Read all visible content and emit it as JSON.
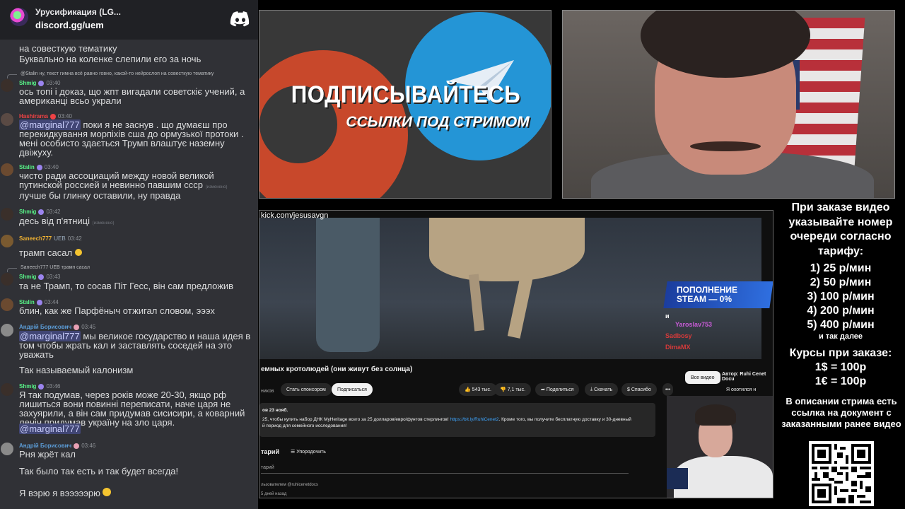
{
  "discord": {
    "server_name": "Урусификация (LG...",
    "invite": "discord.gg/uem"
  },
  "chat": {
    "top_lines": [
      "на совесткую тематику",
      "Буквально на коленке слепили его за ночь"
    ],
    "messages": [
      {
        "reply": "@Stalin ну, текст гимна всё равно говно, какой-то нейрослоп на совесткую тематику",
        "user": "Shmig",
        "color": "#57f287",
        "time": "03:40",
        "text": "ось топі і доказ, що жпт вигадали советскіє учений, а американці всьо украли"
      },
      {
        "user": "Hashirama",
        "color": "#ed4245",
        "time": "03:40",
        "mention": "@marginal777",
        "text": "поки я не заснув . що думаєш про перекидкування морпіхів сша до ормузької протоки . мені особисто здається Трумп влаштує наземну двіжуху."
      },
      {
        "user": "Stalin",
        "color": "#57f287",
        "time": "03:40",
        "text": "чисто ради ассоциаций между новой великой путинской россией и невинно павшим ссср",
        "edited": "(изменено)",
        "text2": "лучше бы глинку оставили, ну правда"
      },
      {
        "user": "Shmig",
        "color": "#57f287",
        "time": "03:42",
        "text": "десь від п'ятниці",
        "edited": "(изменено)"
      },
      {
        "user": "Saneech777",
        "color": "#f0b232",
        "badge": "UEB",
        "time": "03:42",
        "text": "трамп сасал"
      },
      {
        "reply": "Saneech777 UEB трамп сасал",
        "user": "Shmig",
        "color": "#57f287",
        "time": "03:43",
        "text": "та не Трамп, то сосав Піт Гесс, він сам предложив"
      },
      {
        "user": "Stalin",
        "color": "#57f287",
        "time": "03:44",
        "text": "блин, как же Парфёныч отжигал словом, эээх"
      },
      {
        "user": "Андрій Борисович",
        "color": "#5b9bd5",
        "time": "03:45",
        "mention": "@marginal777",
        "text": "мы великое государство и наша идея в том чтобы жрать кал и заставлять соседей на это уважать",
        "text2": "Так называемый калонизм"
      },
      {
        "user": "Shmig",
        "color": "#57f287",
        "time": "03:46",
        "text": "Я так подумав, через років може 20-30, якщо рф лишиться вони повинні переписати, наче царя не захуярили, а він сам придумав сисисири, а коварний ленін придумав україну на зло царя.",
        "mention2": "@marginal777"
      },
      {
        "user": "Андрій Борисович",
        "color": "#5b9bd5",
        "time": "03:46",
        "text": "Рня жрёт кал",
        "text2": "Так было так есть и так будет всегда!",
        "text3": "Я вэрю я вэээээрю"
      }
    ]
  },
  "promo": {
    "title": "ПОДПИСЫВАЙТЕСЬ",
    "subtitle": "ССЫЛКИ ПОД СТРИМОМ"
  },
  "video": {
    "url": "kick.com/jesusavgn",
    "steam_banner": "ПОПОЛНЕНИЕ STEAM — 0%",
    "donors": [
      {
        "name": "Yaroslav753",
        "color": "#c85bd6"
      },
      {
        "name": "Sadbosy",
        "color": "#d63a3a"
      },
      {
        "name": "DimaMX",
        "color": "#d63a3a"
      }
    ],
    "donor_prefix": "и",
    "yt_title": "емных кротолюдей (они живут без солнца)",
    "yt_channel_sub": "ников",
    "btn_sponsor": "Стать спонсором",
    "btn_subscribe": "Подписаться",
    "likes": "543 тыс.",
    "dislikes": "7,1 тыс.",
    "btn_share": "Поделиться",
    "btn_download": "Скачать",
    "btn_thanks": "Спасибо",
    "chip_all": "Все видео",
    "chip_author": "Автор: Ruhi Cenet Docu",
    "side_text": "Я охотился н",
    "desc_date": "ов  23 нояб.",
    "desc_line1": "25, чтобы купить набор ДНК MyHeritage всего за 25 долларов/евро/фунтов стерлингов!",
    "desc_link": "https://bit.ly/RuhiCenet2",
    "desc_line1b": ". Кроме того, вы получите бесплатную доставку и 30-дневный",
    "desc_line2": "й период для семейного исследования!",
    "comments_title": "тарий",
    "sort_label": "Упорядочить",
    "add_comment": "тарий",
    "comment_author": "льзователем @ruhicenetdocs",
    "comment_time": "5 дней назад"
  },
  "info": {
    "heading": "При заказе видео указывайте номер очереди согласно тарифу:",
    "tariffs": [
      "1) 25 р/мин",
      "2) 50 р/мин",
      "3) 100 р/мин",
      "4) 200 р/мин",
      "5) 400 р/мин"
    ],
    "tariff_more": "и так далее",
    "rates_heading": "Курсы при заказе:",
    "rates": [
      "1$ = 100р",
      "1€ = 100р"
    ],
    "doc_note": "В описании стрима есть ссылка на документ с заказанными ранее видео"
  }
}
